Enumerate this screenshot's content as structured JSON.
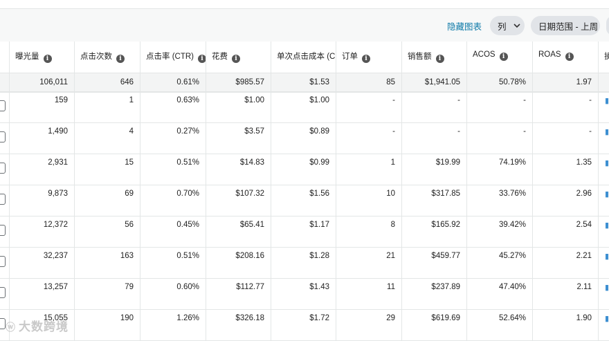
{
  "toolbar": {
    "hide_chart": "隐藏图表",
    "columns": "列",
    "date_range": "日期范围 - 上周"
  },
  "columns": [
    {
      "label": "曝光量"
    },
    {
      "label": "点击次数"
    },
    {
      "label": "点击率 (CTR)"
    },
    {
      "label": "花费"
    },
    {
      "label": "单次点击成本 (CPC)"
    },
    {
      "label": "订单"
    },
    {
      "label": "销售额"
    },
    {
      "label": "ACOS"
    },
    {
      "label": "ROAS"
    },
    {
      "label": "操"
    }
  ],
  "totals": [
    "106,011",
    "646",
    "0.61%",
    "$985.57",
    "$1.53",
    "85",
    "$1,941.05",
    "50.78%",
    "1.97"
  ],
  "rows": [
    [
      "159",
      "1",
      "0.63%",
      "$1.00",
      "$1.00",
      "-",
      "-",
      "-",
      "-"
    ],
    [
      "1,490",
      "4",
      "0.27%",
      "$3.57",
      "$0.89",
      "-",
      "-",
      "-",
      "-"
    ],
    [
      "2,931",
      "15",
      "0.51%",
      "$14.83",
      "$0.99",
      "1",
      "$19.99",
      "74.19%",
      "1.35"
    ],
    [
      "9,873",
      "69",
      "0.70%",
      "$107.32",
      "$1.56",
      "10",
      "$317.85",
      "33.76%",
      "2.96"
    ],
    [
      "12,372",
      "56",
      "0.45%",
      "$65.41",
      "$1.17",
      "8",
      "$165.92",
      "39.42%",
      "2.54"
    ],
    [
      "32,237",
      "163",
      "0.51%",
      "$208.16",
      "$1.28",
      "21",
      "$459.77",
      "45.27%",
      "2.21"
    ],
    [
      "13,257",
      "79",
      "0.60%",
      "$112.77",
      "$1.43",
      "11",
      "$237.89",
      "47.40%",
      "2.11"
    ],
    [
      "15,055",
      "190",
      "1.26%",
      "$326.18",
      "$1.72",
      "29",
      "$619.69",
      "52.64%",
      "1.90"
    ]
  ],
  "watermark": "大数跨境",
  "icons": {
    "info": "info-circle-icon",
    "chevron": "chevron-down-icon",
    "row_action": "bar-chart-icon"
  },
  "colors": {
    "link": "#0e7aa8",
    "pill_bg": "#e1e4e8",
    "totals_bg": "#f3f4f4",
    "grid_line": "#e3e6e6"
  }
}
